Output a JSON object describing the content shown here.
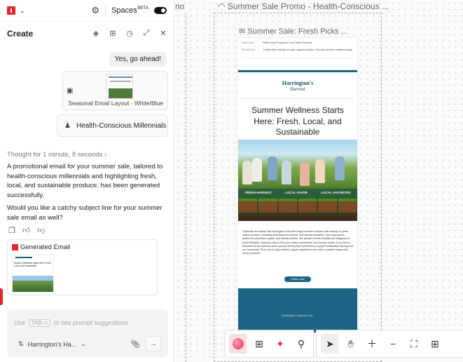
{
  "topbar": {
    "spaces_label": "Spaces",
    "beta_label": "BETA"
  },
  "panel": {
    "title": "Create"
  },
  "chat": {
    "user_message": "Yes, go ahead!",
    "layout_card_label": "Seasonal Email Layout - White/Blue",
    "persona_label": "Health-Conscious Millennials",
    "thought_label": "Thought for 1 minute, 8 seconds",
    "response_1": "A promotional email for your summer sale, tailored to health-conscious millennials and highlighting fresh, local, and sustainable produce, has been generated successfully.",
    "response_2": "Would you like a catchy subject line for your summer sale email as well?",
    "generated_card_title": "Generated Email"
  },
  "input": {
    "placeholder_prefix": "Use",
    "placeholder_key": "TAB",
    "placeholder_suffix": "to see prompt suggestions",
    "brand_label": "Harrington's Ha..."
  },
  "canvas": {
    "left_frame_title": "no",
    "frame_title": "Summer Sale Promo - Health-Conscious ...",
    "email_title": "Summer Sale: Fresh Picks ..."
  },
  "email": {
    "header_rows": [
      {
        "label": "Subject line",
        "value": "Fresh Local Produce for Your Active Summer"
      },
      {
        "label": "Preview text",
        "value": "Limited-time savings on local, organic produce. Fuel your summer wellness today!"
      }
    ],
    "brand_name": "Harrington's",
    "brand_sub": "Harvest",
    "headline": "Summer Wellness Starts Here: Fresh, Local, and Sustainable",
    "cta_1": "Shop now",
    "banner_items": [
      "FRESH HARVEST",
      "LOCAL FAVOR",
      "LOCAL FAVORITES"
    ],
    "body": "Celebrate the season with Harrington's Harvest! Enjoy exclusive summer sale savings on peak-season produce, including antioxidant-rich berries, keto-friendly avocados, and crisp greens – perfect for smoothies, salads, and healthy snacks. Our special summer bundles are designed for active lifestyles, making it easy to fuel your outdoor adventures and summer meals. Every item is harvested at its nutritional best, sourced directly from local fields to support sustainable farming and our community. Shop now to enjoy vibrant, organic ingredients and make a positive impact with every purchase!",
    "cta_2": "Order now",
    "footer": "Harrington's Harvest, Inc."
  },
  "colors": {
    "brand_red": "#e8242d",
    "email_blue": "#1d6585",
    "active_tool": "#f7dfe4"
  },
  "toolbar": {
    "icons": [
      "ai-orb-icon",
      "add-page-icon",
      "sparkle-icon",
      "search-icon",
      "pointer-icon",
      "hand-icon",
      "zoom-in-icon",
      "zoom-out-icon",
      "fit-screen-icon",
      "grid-icon"
    ]
  }
}
